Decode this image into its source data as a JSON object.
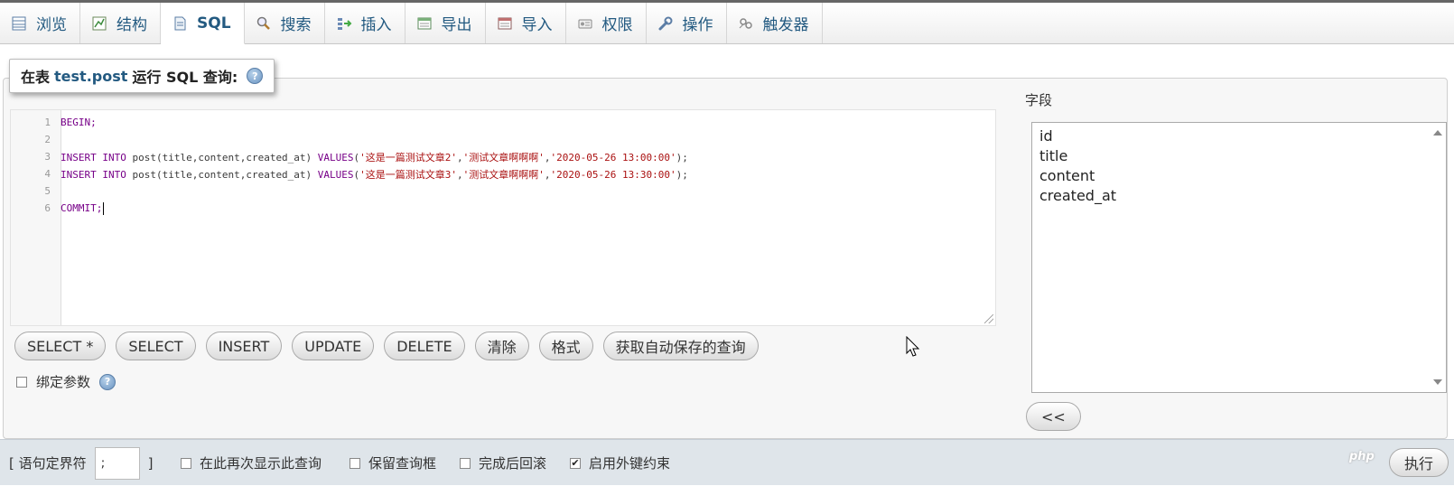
{
  "tabs": [
    {
      "label": "浏览",
      "icon": "browse-table-icon",
      "name": "tab-browse",
      "active": false
    },
    {
      "label": "结构",
      "icon": "structure-icon",
      "name": "tab-structure",
      "active": false
    },
    {
      "label": "SQL",
      "icon": "sql-icon",
      "name": "tab-sql",
      "active": true
    },
    {
      "label": "搜索",
      "icon": "search-icon",
      "name": "tab-search",
      "active": false
    },
    {
      "label": "插入",
      "icon": "insert-icon",
      "name": "tab-insert",
      "active": false
    },
    {
      "label": "导出",
      "icon": "export-icon",
      "name": "tab-export",
      "active": false
    },
    {
      "label": "导入",
      "icon": "import-icon",
      "name": "tab-import",
      "active": false
    },
    {
      "label": "权限",
      "icon": "privileges-icon",
      "name": "tab-privileges",
      "active": false
    },
    {
      "label": "操作",
      "icon": "wrench-icon",
      "name": "tab-operations",
      "active": false
    },
    {
      "label": "触发器",
      "icon": "triggers-icon",
      "name": "tab-triggers",
      "active": false
    }
  ],
  "legend": {
    "prefix": "在表",
    "table": "test.post",
    "suffix": "运行 SQL 查询:",
    "help": "?"
  },
  "editor": {
    "lines": [
      {
        "num": "1",
        "text": "BEGIN;"
      },
      {
        "num": "2",
        "text": ""
      },
      {
        "num": "3",
        "text": "INSERT INTO post(title,content,created_at) VALUES('这是一篇测试文章2','测试文章啊啊啊','2020-05-26 13:00:00');"
      },
      {
        "num": "4",
        "text": "INSERT INTO post(title,content,created_at) VALUES('这是一篇测试文章3','测试文章啊啊啊','2020-05-26 13:30:00');"
      },
      {
        "num": "5",
        "text": ""
      },
      {
        "num": "6",
        "text": "COMMIT;"
      }
    ]
  },
  "buttons": {
    "select_all": "SELECT *",
    "select": "SELECT",
    "insert": "INSERT",
    "update": "UPDATE",
    "delete": "DELETE",
    "clear": "清除",
    "format": "格式",
    "autosave": "获取自动保存的查询"
  },
  "bind_params": {
    "label": "绑定参数",
    "checked": false
  },
  "fields": {
    "label": "字段",
    "items": [
      "id",
      "title",
      "content",
      "created_at"
    ],
    "insert_button": "<<"
  },
  "footer": {
    "delimiter_label_open": "[ 语句定界符",
    "delimiter_value": ";",
    "delimiter_label_close": "]",
    "show_again": {
      "label": "在此再次显示此查询",
      "checked": false
    },
    "retain_box": {
      "label": "保留查询框",
      "checked": false
    },
    "rollback": {
      "label": "完成后回滚",
      "checked": false
    },
    "foreign_keys": {
      "label": "启用外键约束",
      "checked": true
    },
    "go_button": "执行"
  },
  "watermark": "php"
}
